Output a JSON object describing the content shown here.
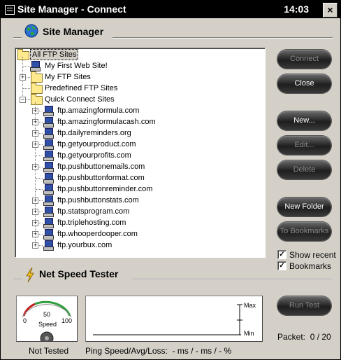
{
  "window": {
    "title": "Site Manager - Connect",
    "clock": "14:03",
    "close_glyph": "×"
  },
  "site_manager": {
    "heading": "Site Manager",
    "icon": "globe-icon"
  },
  "tree": {
    "root": "All FTP Sites",
    "items": [
      {
        "label": "My First Web Site!",
        "icon": "computer-icon"
      },
      {
        "label": "My FTP Sites",
        "icon": "folder-icon"
      },
      {
        "label": "Predefined FTP Sites",
        "icon": "folder-icon"
      },
      {
        "label": "Quick Connect Sites",
        "icon": "folder-icon"
      }
    ],
    "quick_sites": [
      "ftp.amazingformula.com",
      "ftp.amazingformulacash.com",
      "ftp.dailyreminders.org",
      "ftp.getyourproduct.com",
      "ftp.getyourprofits.com",
      "ftp.pushbuttonemails.com",
      "ftp.pushbuttonformat.com",
      "ftp.pushbuttonreminder.com",
      "ftp.pushbuttonstats.com",
      "ftp.statsprogram.com",
      "ftp.triplehosting.com",
      "ftp.whooperdooper.com",
      "ftp.yourbux.com"
    ],
    "expand_glyph": "+",
    "collapse_glyph": "−"
  },
  "buttons": {
    "connect": "Connect",
    "close": "Close",
    "new": "New...",
    "edit": "Edit...",
    "delete": "Delete",
    "new_folder": "New Folder",
    "to_bookmarks": "To Bookmarks",
    "run_test": "Run Test"
  },
  "options": {
    "show_recent": {
      "label": "Show recent",
      "checked": true
    },
    "bookmarks": {
      "label": "Bookmarks",
      "checked": true
    },
    "check_glyph": "✓"
  },
  "net_speed": {
    "heading": "Net Speed Tester",
    "icon": "lightning-icon",
    "gauge": {
      "min": "0",
      "mid": "50",
      "max": "100",
      "label": "Speed"
    },
    "status": "Not Tested",
    "graph": {
      "max_label": "Max",
      "min_label": "Min"
    },
    "ping_text": "Ping Speed/Avg/Loss:  - ms / - ms / - %",
    "packet_text": "Packet:  0 / 20"
  },
  "colors": {
    "titlebar": "#000000",
    "window": "#d4d0c8",
    "gauge_green": "#2e9e3c",
    "gauge_red": "#c02020"
  }
}
